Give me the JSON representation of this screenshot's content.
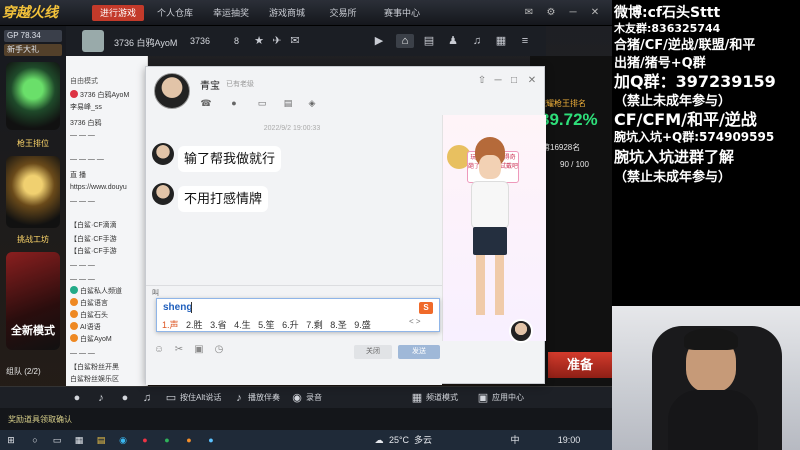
{
  "game": {
    "logo": "穿越火线",
    "tabs": [
      "进行游戏",
      "个人仓库",
      "幸运抽奖",
      "游戏商城",
      "交易所",
      "赛事中心"
    ],
    "level": "GP",
    "level_value": "78.34",
    "new_user_label": "新手大礼",
    "player_id": "3736 白鸦AyoM",
    "player_num": "3736",
    "friends_count": "8",
    "badges": [
      {
        "label": "枪王排位"
      },
      {
        "label": "挑战工坊"
      },
      {
        "label": "全新模式"
      }
    ],
    "right_panel": {
      "title": "荣耀枪王排名",
      "percent": "39.72%",
      "week_label": "第16928名",
      "progress": "90 / 100"
    },
    "ready_button": "准备",
    "team_label": "组队 (2/2)",
    "bottom_bar": {
      "voice_button": "按住Alt说话",
      "music_button": "播放伴奏",
      "record_button": "录音",
      "channel_button": "频道模式",
      "app_button": "应用中心"
    },
    "status_text": "奖励道具领取确认"
  },
  "qq_list": {
    "mode_label": "自由模式",
    "rows": [
      "3736 白鸦AyoM",
      "李易峰_ss",
      "3736 白鸦",
      "— — —",
      "— — — —",
      "直 播",
      "https://www.douyu",
      "— — —",
      "【白鲨·CF滴滴",
      "【白鲨·CF手游",
      "【白鲨·CF手游",
      "— — —",
      "— — —",
      "白鲨私人频道",
      "白鲨语言",
      "白鲨石头",
      "AI语语",
      "白鲨AyoM",
      "— — —",
      "【白鲨粉丝开黑",
      "白鲨粉丝娱乐区",
      "白鲨粉丝区"
    ]
  },
  "chat": {
    "contact_name": "青宝",
    "contact_status": "已有老级",
    "timestamp": "2022/9/2 19:00:33",
    "messages": [
      {
        "text": "输了帮我做就行"
      },
      {
        "text": "不用打感情牌"
      }
    ],
    "show_tip": "玩QQ秀啦！得奇葩了你-点我试戴吧",
    "input_text": "叫",
    "close_button": "关闭",
    "send_button": "发送"
  },
  "ime": {
    "composition": "sheng",
    "candidates": [
      "1.声",
      "2.胜",
      "3.省",
      "4.生",
      "5.笙",
      "6.升",
      "7.剩",
      "8.圣",
      "9.盛"
    ],
    "logo": "S",
    "nav": "< >"
  },
  "overlay": {
    "lines": [
      "微博:cf石头Sttt",
      "木友群:836325744",
      "合猪/CF/逆战/联盟/和平",
      "出猪/猪号+Q群",
      "加Q群：397239159",
      "（禁止未成年参与）",
      "CF/CFM/和平/逆战",
      "腕坑入坑+Q群:574909595",
      "腕坑入坑进群了解",
      "（禁止未成年参与）"
    ]
  },
  "taskbar": {
    "temperature": "25°C",
    "weather": "多云",
    "clock": "19:00",
    "lang": "中"
  }
}
